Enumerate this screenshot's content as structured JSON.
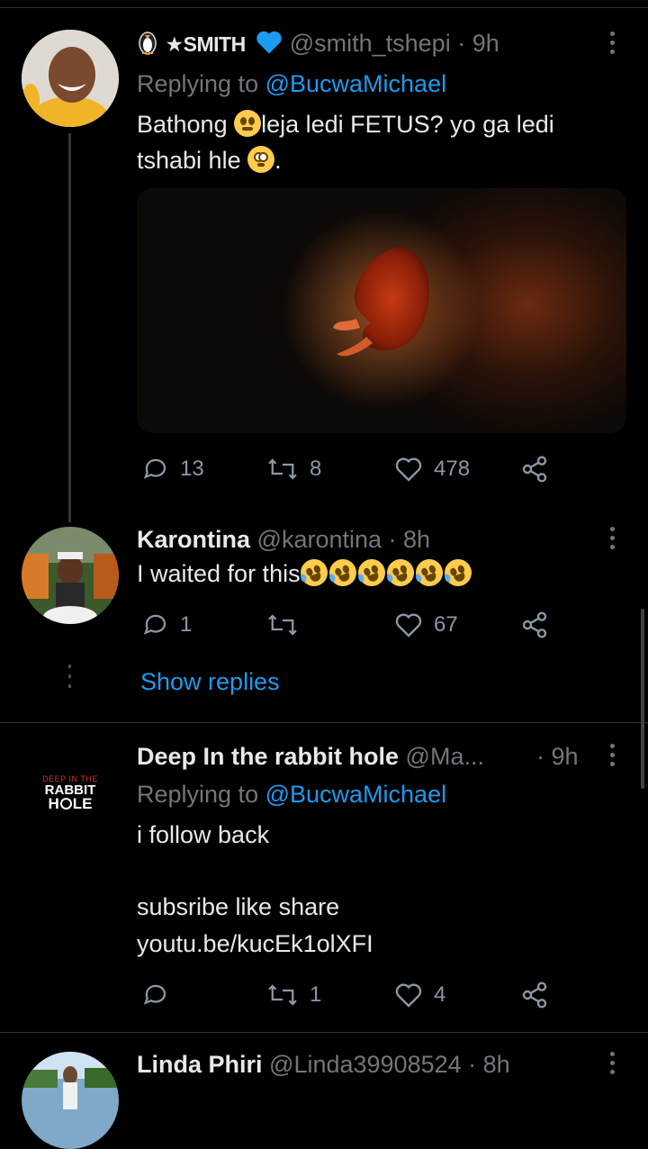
{
  "tweets": [
    {
      "display_name": "★SMITH",
      "handle": "@smith_tshepi",
      "time": "· 9h",
      "replying_prefix": "Replying to ",
      "replying_to": "@BucwaMichael",
      "text_line1_a": "Bathong ",
      "text_line1_b": "leja ledi FETUS? yo ga ledi",
      "text_line2": "tshabi hle ",
      "text_line2_end": ".",
      "replies": "13",
      "retweets": "8",
      "likes": "478"
    },
    {
      "display_name": "Karontina",
      "handle": "@karontina",
      "time": "· 8h",
      "text": "I waited for this",
      "replies": "1",
      "retweets": "",
      "likes": "67",
      "show_replies": "Show replies"
    },
    {
      "display_name": "Deep In the rabbit hole",
      "handle": "@Ma...",
      "time": "· 9h",
      "avatar_lines": [
        "DEEP IN THE",
        "RABBIT",
        "H",
        "LE"
      ],
      "replying_prefix": "Replying to ",
      "replying_to": "@BucwaMichael",
      "text_line1": "i follow back",
      "text_line2": "subsribe like share",
      "link": "youtu.be/kucEk1olXFI",
      "replies": "",
      "retweets": "1",
      "likes": "4"
    },
    {
      "display_name": "Linda Phiri",
      "handle": "@Linda39908524",
      "time": "· 8h"
    }
  ],
  "colors": {
    "background": "#000000",
    "text": "#e7e9ea",
    "muted": "#71767b",
    "link": "#1d9bf0",
    "verified": "#1d9bf0"
  }
}
